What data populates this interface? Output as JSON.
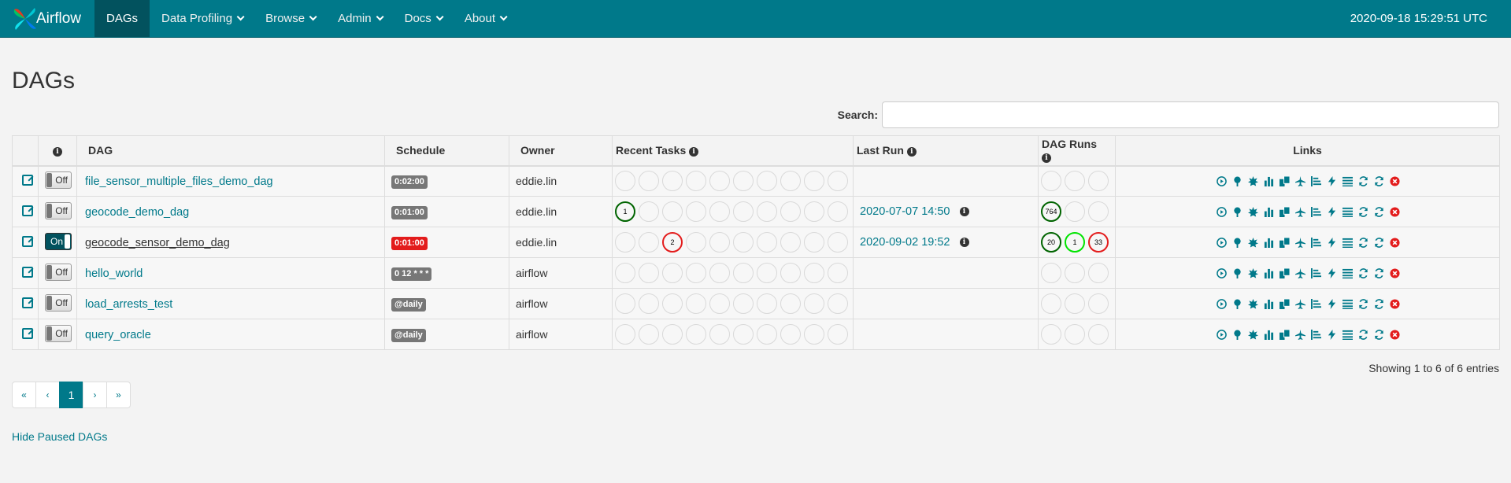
{
  "brand": "Airflow",
  "nav": [
    {
      "label": "DAGs",
      "active": true,
      "caret": false
    },
    {
      "label": "Data Profiling",
      "caret": true
    },
    {
      "label": "Browse",
      "caret": true
    },
    {
      "label": "Admin",
      "caret": true
    },
    {
      "label": "Docs",
      "caret": true
    },
    {
      "label": "About",
      "caret": true
    }
  ],
  "clock": "2020-09-18 15:29:51 UTC",
  "page_title": "DAGs",
  "search": {
    "label": "Search:",
    "value": ""
  },
  "columns": {
    "dag": "DAG",
    "schedule": "Schedule",
    "owner": "Owner",
    "recent_tasks": "Recent Tasks",
    "last_run": "Last Run",
    "dag_runs": "DAG Runs",
    "links": "Links"
  },
  "rows": [
    {
      "dag": "file_sensor_multiple_files_demo_dag",
      "toggle": "Off",
      "schedule": "0:02:00",
      "schedule_color": "gray",
      "owner": "eddie.lin",
      "last_run": "",
      "recent_tasks": [
        "",
        "",
        "",
        "",
        "",
        "",
        "",
        "",
        "",
        ""
      ],
      "dag_runs": [
        "",
        "",
        ""
      ]
    },
    {
      "dag": "geocode_demo_dag",
      "toggle": "Off",
      "schedule": "0:01:00",
      "schedule_color": "gray",
      "owner": "eddie.lin",
      "last_run": "2020-07-07 14:50",
      "recent_tasks": [
        "1:green",
        "",
        "",
        "",
        "",
        "",
        "",
        "",
        "",
        ""
      ],
      "dag_runs": [
        "764:green",
        "",
        ""
      ]
    },
    {
      "dag": "geocode_sensor_demo_dag",
      "toggle": "On",
      "schedule": "0:01:00",
      "schedule_color": "red",
      "owner": "eddie.lin",
      "last_run": "2020-09-02 19:52",
      "recent_tasks": [
        "",
        "",
        "2:red",
        "",
        "",
        "",
        "",
        "",
        "",
        ""
      ],
      "dag_runs": [
        "20:green",
        "1:lime",
        "33:red"
      ]
    },
    {
      "dag": "hello_world",
      "toggle": "Off",
      "schedule": "0 12 * * *",
      "schedule_color": "gray",
      "owner": "airflow",
      "last_run": "",
      "recent_tasks": [
        "",
        "",
        "",
        "",
        "",
        "",
        "",
        "",
        "",
        ""
      ],
      "dag_runs": [
        "",
        "",
        ""
      ]
    },
    {
      "dag": "load_arrests_test",
      "toggle": "Off",
      "schedule": "@daily",
      "schedule_color": "gray",
      "owner": "airflow",
      "last_run": "",
      "recent_tasks": [
        "",
        "",
        "",
        "",
        "",
        "",
        "",
        "",
        "",
        ""
      ],
      "dag_runs": [
        "",
        "",
        ""
      ]
    },
    {
      "dag": "query_oracle",
      "toggle": "Off",
      "schedule": "@daily",
      "schedule_color": "gray",
      "owner": "airflow",
      "last_run": "",
      "recent_tasks": [
        "",
        "",
        "",
        "",
        "",
        "",
        "",
        "",
        "",
        ""
      ],
      "dag_runs": [
        "",
        "",
        ""
      ]
    }
  ],
  "link_icons": [
    "trigger-dag-icon",
    "tree-view-icon",
    "graph-view-icon",
    "tries-chart-icon",
    "duration-icon",
    "landing-times-icon",
    "gantt-icon",
    "task-duration-icon",
    "code-icon",
    "logs-icon",
    "refresh-icon",
    "delete-icon"
  ],
  "showing": "Showing 1 to 6 of 6 entries",
  "pager": [
    "«",
    "‹",
    "1",
    "›",
    "»"
  ],
  "pager_active": "1",
  "hide_paused": "Hide Paused DAGs",
  "colors": {
    "navbar": "#00798a",
    "nav_active": "#02525e",
    "link": "#00798a",
    "success": "#006400",
    "running": "#00e400",
    "failed": "#e31c1c"
  }
}
